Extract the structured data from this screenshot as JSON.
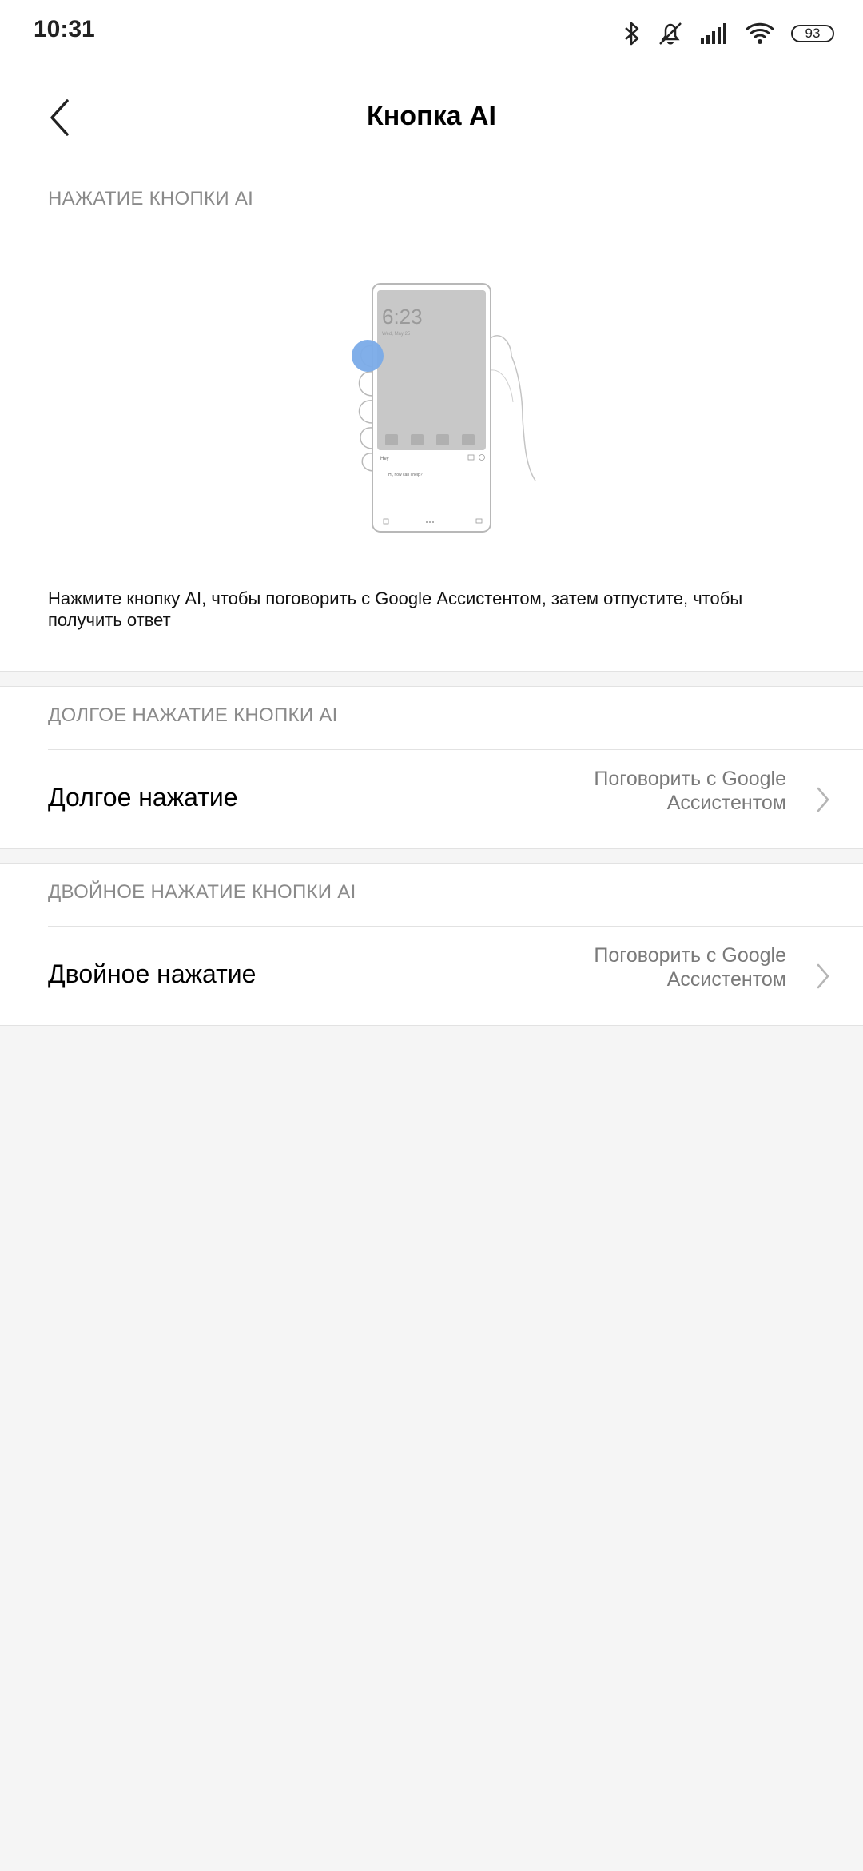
{
  "status_bar": {
    "time": "10:31",
    "battery": "93",
    "icons": [
      "bluetooth-icon",
      "mute-bell-icon",
      "signal-icon",
      "wifi-icon",
      "battery-icon"
    ]
  },
  "app_bar": {
    "title": "Кнопка AI",
    "back_icon": "chevron-left-icon"
  },
  "sections": [
    {
      "header": "НАЖАТИЕ КНОПКИ AI",
      "illustration": {
        "name": "phone-press-illustration",
        "screen_time": "6:23",
        "screen_date": "Wed, May 25",
        "assistant_greeting": "Hi, how can I help?",
        "assistant_label": "Hey"
      },
      "description": "Нажмите кнопку AI, чтобы поговорить с Google Ассистентом, затем отпустите, чтобы получить ответ"
    },
    {
      "header": "ДОЛГОЕ НАЖАТИЕ КНОПКИ AI",
      "row": {
        "label": "Долгое нажатие",
        "value": "Поговорить с Google Ассистентом"
      }
    },
    {
      "header": "ДВОЙНОЕ НАЖАТИЕ КНОПКИ AI",
      "row": {
        "label": "Двойное нажатие",
        "value": "Поговорить с Google Ассистентом"
      }
    }
  ],
  "colors": {
    "background": "#f5f5f5",
    "card": "#ffffff",
    "header_text": "#8a8a8a",
    "value_text": "#7a7a7a",
    "accent_blue": "#7aabe8"
  }
}
